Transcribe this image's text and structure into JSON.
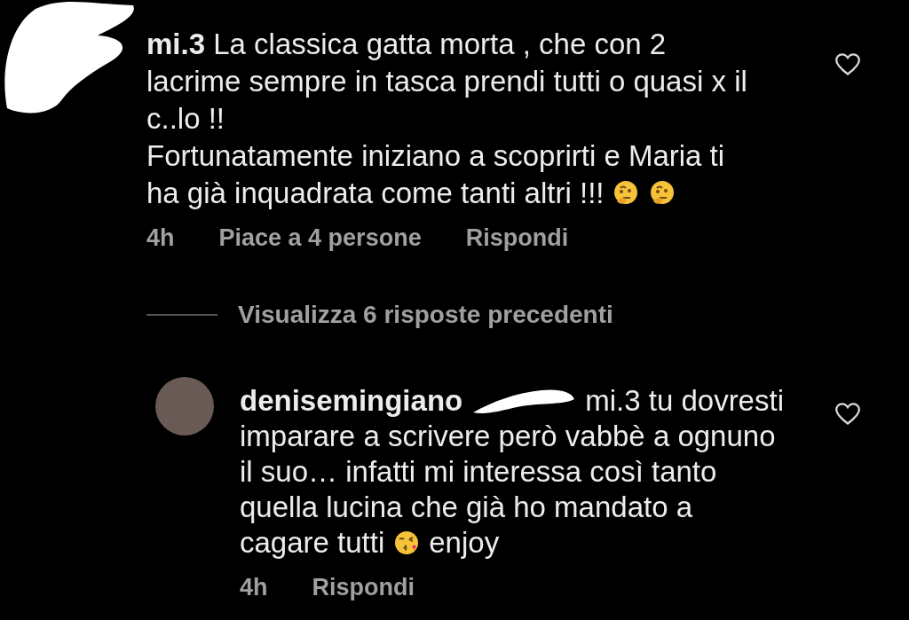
{
  "comment": {
    "lines": [
      [
        {
          "kind": "text",
          "text": "**mi.3** La classica gatta morta , che con 2"
        }
      ],
      [
        {
          "kind": "text",
          "text": "lacrime sempre in tasca prendi tutti o quasi x il"
        }
      ],
      [
        {
          "kind": "text",
          "text": "c..lo !!"
        }
      ],
      [
        {
          "kind": "text",
          "text": "Fortunatamente iniziano a scoprirti e Maria ti"
        }
      ],
      [
        {
          "kind": "text",
          "text": "ha già inquadrata come tanti altri !!!"
        },
        {
          "kind": "thinking"
        },
        {
          "kind": "thinking"
        }
      ]
    ],
    "time": "4h",
    "likes": "Piace a 4 persone",
    "reply": "Rispondi",
    "liked": false
  },
  "view_replies": "Visualizza 6 risposte precedenti",
  "reply": {
    "lines": [
      [
        {
          "kind": "text",
          "text": "**denisemingiano**"
        },
        {
          "kind": "scribble"
        },
        {
          "kind": "text",
          "text": "mi.3 tu dovresti"
        }
      ],
      [
        {
          "kind": "text",
          "text": "imparare a scrivere però vabbè a ognuno"
        }
      ],
      [
        {
          "kind": "text",
          "text": "il suo… infatti mi interessa così tanto"
        }
      ],
      [
        {
          "kind": "text",
          "text": "quella lucina che già ho mandato a"
        }
      ],
      [
        {
          "kind": "text",
          "text": "cagare tutti"
        },
        {
          "kind": "kiss"
        },
        {
          "kind": "text",
          "text": "enjoy"
        }
      ]
    ],
    "time": "4h",
    "reply": "Rispondi",
    "liked": false
  }
}
